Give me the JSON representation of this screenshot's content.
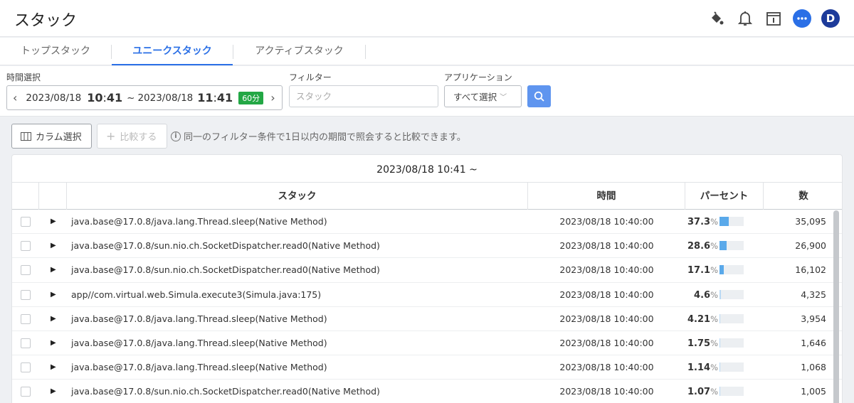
{
  "header": {
    "title": "スタック"
  },
  "user": {
    "avatar_initial": "D"
  },
  "tabs": [
    {
      "label": "トップスタック"
    },
    {
      "label": "ユニークスタック"
    },
    {
      "label": "アクティブスタック"
    }
  ],
  "filters": {
    "time_label": "時間選択",
    "time": {
      "start_date": "2023/08/18",
      "start_hour": "10",
      "start_min": "41",
      "separator": "~",
      "end_date": "2023/08/18",
      "end_hour": "11",
      "end_min": "41",
      "duration_badge": "60分"
    },
    "filter_label": "フィルター",
    "filter_placeholder": "スタック",
    "application_label": "アプリケーション",
    "application_value": "すべて選択"
  },
  "toolbar": {
    "columns_button": "カラム選択",
    "compare_button": "比較する",
    "info_text": "同一のフィルター条件で1日以内の期間で照会すると比較できます。"
  },
  "table": {
    "title": "2023/08/18 10:41 ~",
    "columns": [
      "スタック",
      "時間",
      "パーセント",
      "数"
    ],
    "percent_sign": "%",
    "rows": [
      {
        "stack": "java.base@17.0.8/java.lang.Thread.sleep(Native Method)",
        "time": "2023/08/18 10:40:00",
        "percent": "37.3",
        "percent_value": 37.3,
        "count": "35,095"
      },
      {
        "stack": "java.base@17.0.8/sun.nio.ch.SocketDispatcher.read0(Native Method)",
        "time": "2023/08/18 10:40:00",
        "percent": "28.6",
        "percent_value": 28.6,
        "count": "26,900"
      },
      {
        "stack": "java.base@17.0.8/sun.nio.ch.SocketDispatcher.read0(Native Method)",
        "time": "2023/08/18 10:40:00",
        "percent": "17.1",
        "percent_value": 17.1,
        "count": "16,102"
      },
      {
        "stack": "app//com.virtual.web.Simula.execute3(Simula.java:175)",
        "time": "2023/08/18 10:40:00",
        "percent": "4.6",
        "percent_value": 4.6,
        "count": "4,325"
      },
      {
        "stack": "java.base@17.0.8/java.lang.Thread.sleep(Native Method)",
        "time": "2023/08/18 10:40:00",
        "percent": "4.21",
        "percent_value": 4.21,
        "count": "3,954"
      },
      {
        "stack": "java.base@17.0.8/java.lang.Thread.sleep(Native Method)",
        "time": "2023/08/18 10:40:00",
        "percent": "1.75",
        "percent_value": 1.75,
        "count": "1,646"
      },
      {
        "stack": "java.base@17.0.8/java.lang.Thread.sleep(Native Method)",
        "time": "2023/08/18 10:40:00",
        "percent": "1.14",
        "percent_value": 1.14,
        "count": "1,068"
      },
      {
        "stack": "java.base@17.0.8/sun.nio.ch.SocketDispatcher.read0(Native Method)",
        "time": "2023/08/18 10:40:00",
        "percent": "1.07",
        "percent_value": 1.07,
        "count": "1,005"
      }
    ]
  },
  "colors": {
    "accent": "#2a6fe6",
    "badge_green": "#23a745",
    "bar_blue": "#5aa9ea",
    "avatar": "#1d3b9a"
  }
}
